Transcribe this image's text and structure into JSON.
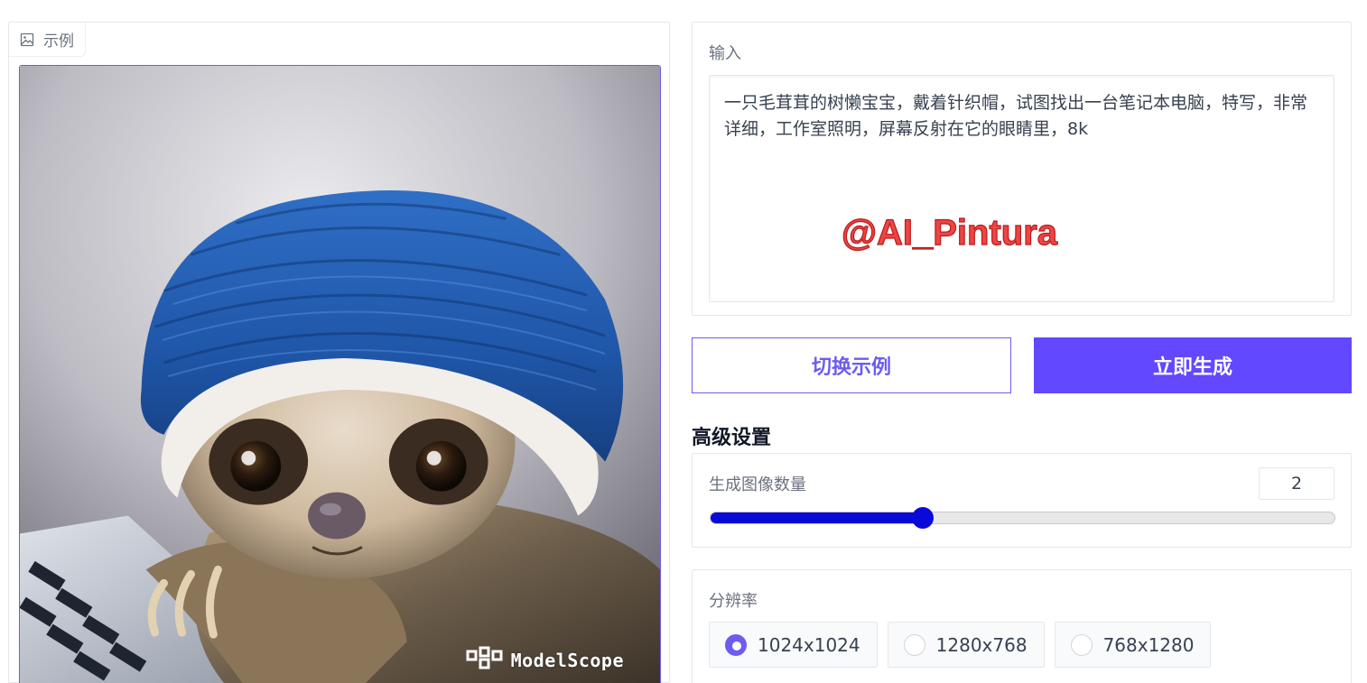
{
  "example": {
    "tag_label": "示例",
    "tag_icon": "image-icon",
    "watermark_text": "ModelScope",
    "watermark_icon": "modelscope-logo-icon"
  },
  "input": {
    "label": "输入",
    "prompt": "一只毛茸茸的树懒宝宝，戴着针织帽，试图找出一台笔记本电脑，特写，非常详细，工作室照明，屏幕反射在它的眼睛里，8k",
    "overlay_handle": "@AI_Pintura"
  },
  "actions": {
    "switch_label": "切换示例",
    "generate_label": "立即生成"
  },
  "advanced": {
    "title": "高级设置",
    "count": {
      "label": "生成图像数量",
      "value": "2",
      "slider_fraction": 0.34
    },
    "resolution": {
      "label": "分辨率",
      "options": [
        "1024x1024",
        "1280x768",
        "768x1280"
      ],
      "selected": "1024x1024"
    }
  },
  "colors": {
    "accent": "#6248ff",
    "accent_border": "#6d5cf0",
    "slider": "#0a0ad8",
    "handle_red": "#ee4444"
  }
}
